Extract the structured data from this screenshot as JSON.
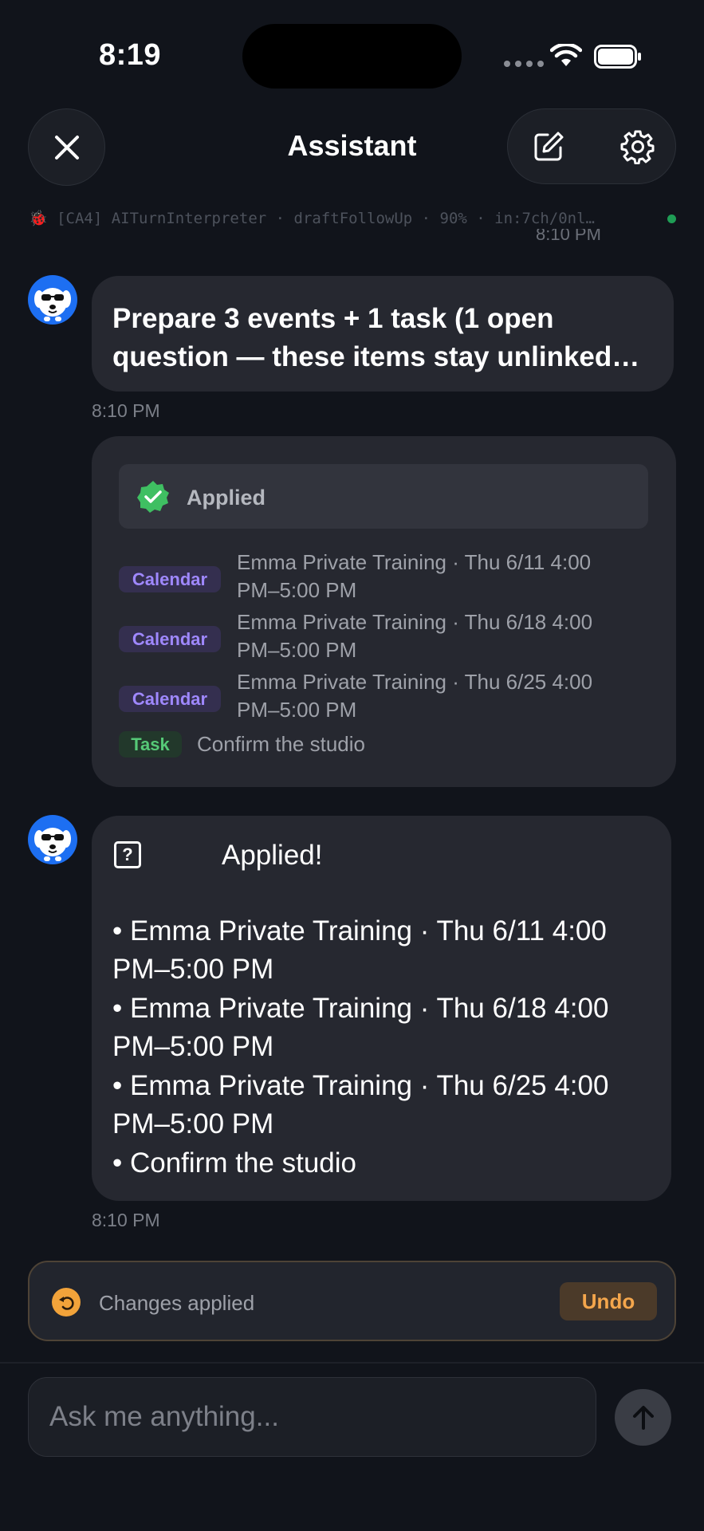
{
  "status_bar": {
    "time": "8:19"
  },
  "header": {
    "title": "Assistant"
  },
  "debug": {
    "text": "🐞 [CA4] AITurnInterpreter · draftFollowUp · 90% · in:7ch/0nl…",
    "previous_time": "8:10 PM"
  },
  "messages": [
    {
      "text": "Prepare 3 events + 1 task (1 open question — these items stay unlinked…",
      "time": "8:10 PM"
    }
  ],
  "applied_card": {
    "status": "Applied",
    "items": [
      {
        "badge": "Calendar",
        "line1": "Emma Private Training · Thu 6/11 4:00",
        "line2": "PM–5:00 PM"
      },
      {
        "badge": "Calendar",
        "line1": "Emma Private Training · Thu 6/18 4:00",
        "line2": "PM–5:00 PM"
      },
      {
        "badge": "Calendar",
        "line1": "Emma Private Training · Thu 6/25 4:00",
        "line2": "PM–5:00 PM"
      },
      {
        "badge": "Task",
        "line1": "Confirm the studio"
      }
    ]
  },
  "reply": {
    "icon_char": "?",
    "title": "Applied!",
    "lines": [
      "• Emma Private Training · Thu 6/11 4:00",
      "PM–5:00 PM",
      "• Emma Private Training · Thu 6/18 4:00",
      "PM–5:00 PM",
      "• Emma Private Training · Thu 6/25 4:00",
      "PM–5:00 PM",
      "• Confirm the studio"
    ],
    "time": "8:10 PM"
  },
  "undo_bar": {
    "label": "Changes applied",
    "button": "Undo"
  },
  "composer": {
    "placeholder": "Ask me anything..."
  },
  "icons": {
    "close": "close-icon",
    "compose": "compose-icon",
    "settings": "gear-icon",
    "avatar": "dog-sunglasses-avatar",
    "check": "check-badge-icon",
    "undo": "undo-arrow-icon",
    "send": "arrow-up-icon"
  },
  "colors": {
    "accent_orange": "#f4a64c",
    "calendar_badge": "#9f88ff",
    "task_badge": "#56c977",
    "avatar_blue": "#1d6ff2"
  }
}
